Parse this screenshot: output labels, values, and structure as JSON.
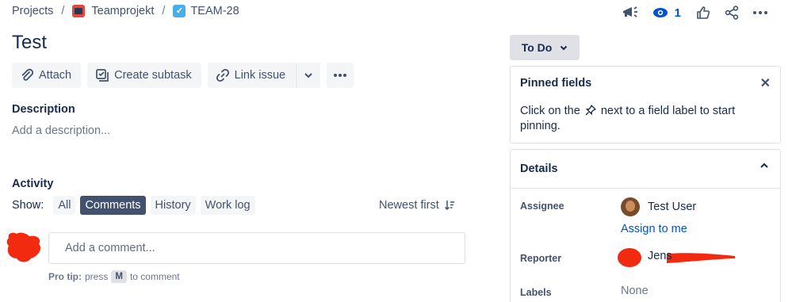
{
  "breadcrumb": {
    "projects": "Projects",
    "separator": "/",
    "project": "Teamprojekt",
    "issue_key": "TEAM-28"
  },
  "header": {
    "watchers_count": "1"
  },
  "issue": {
    "title": "Test"
  },
  "toolbar": {
    "attach": "Attach",
    "create_subtask": "Create subtask",
    "link_issue": "Link issue"
  },
  "description": {
    "heading": "Description",
    "placeholder": "Add a description..."
  },
  "activity": {
    "heading": "Activity",
    "show_label": "Show:",
    "filters": [
      "All",
      "Comments",
      "History",
      "Work log"
    ],
    "active_filter": "Comments",
    "sort": "Newest first"
  },
  "comment": {
    "placeholder": "Add a comment...",
    "protip_prefix": "Pro tip:",
    "protip_press": "press",
    "protip_key": "M",
    "protip_suffix": "to comment"
  },
  "status": {
    "label": "To Do"
  },
  "pinned": {
    "heading": "Pinned fields",
    "text_before": "Click on the",
    "text_after": "next to a field label to start pinning."
  },
  "details": {
    "heading": "Details",
    "assignee_label": "Assignee",
    "assignee_value": "Test User",
    "assign_to_me": "Assign to me",
    "reporter_label": "Reporter",
    "reporter_value": "Jens",
    "labels_label": "Labels",
    "labels_value": "None"
  },
  "colors": {
    "accent": "#0052cc",
    "active_filter_bg": "#42526e",
    "redaction": "#f22a10"
  },
  "icons": [
    "paperclip-icon",
    "subtask-icon",
    "link-icon",
    "chevron-down-icon",
    "more-icon",
    "megaphone-icon",
    "eye-icon",
    "thumbs-up-icon",
    "share-icon",
    "close-icon",
    "pin-icon",
    "sort-icon"
  ]
}
